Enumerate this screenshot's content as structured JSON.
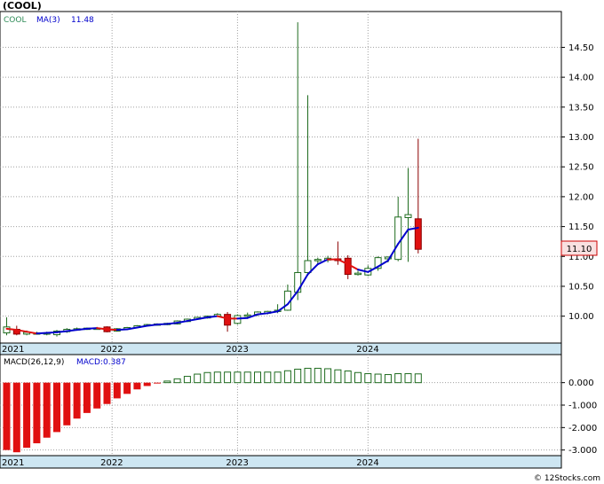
{
  "chart_data": {
    "type": "candlestick",
    "title": "(COOL)",
    "ticker_label": "COOL",
    "ma_label": "MA(3)",
    "ma_value": "11.48",
    "last_price": "11.10",
    "watermark": "© 12Stocks.com",
    "ylim": [
      9.55,
      15.1
    ],
    "yticks": [
      "10.00",
      "10.50",
      "11.00",
      "11.50",
      "12.00",
      "12.50",
      "13.00",
      "13.50",
      "14.00",
      "14.50"
    ],
    "years": [
      {
        "label": "2021",
        "index": 0
      },
      {
        "label": "2022",
        "index": 10.5
      },
      {
        "label": "2023",
        "index": 23
      },
      {
        "label": "2024",
        "index": 36
      }
    ],
    "candles": [
      {
        "o": 9.72,
        "h": 9.98,
        "l": 9.68,
        "c": 9.82,
        "up": true
      },
      {
        "o": 9.78,
        "h": 9.84,
        "l": 9.68,
        "c": 9.7,
        "up": false
      },
      {
        "o": 9.7,
        "h": 9.76,
        "l": 9.68,
        "c": 9.73,
        "up": true
      },
      {
        "o": 9.71,
        "h": 9.74,
        "l": 9.69,
        "c": 9.72,
        "up": true
      },
      {
        "o": 9.71,
        "h": 9.74,
        "l": 9.68,
        "c": 9.72,
        "up": true
      },
      {
        "o": 9.69,
        "h": 9.77,
        "l": 9.66,
        "c": 9.75,
        "up": true
      },
      {
        "o": 9.74,
        "h": 9.8,
        "l": 9.72,
        "c": 9.78,
        "up": true
      },
      {
        "o": 9.77,
        "h": 9.81,
        "l": 9.76,
        "c": 9.79,
        "up": true
      },
      {
        "o": 9.78,
        "h": 9.81,
        "l": 9.77,
        "c": 9.8,
        "up": true
      },
      {
        "o": 9.79,
        "h": 9.82,
        "l": 9.78,
        "c": 9.8,
        "up": true
      },
      {
        "o": 9.82,
        "h": 9.83,
        "l": 9.73,
        "c": 9.74,
        "up": false
      },
      {
        "o": 9.75,
        "h": 9.8,
        "l": 9.74,
        "c": 9.79,
        "up": true
      },
      {
        "o": 9.79,
        "h": 9.82,
        "l": 9.78,
        "c": 9.81,
        "up": true
      },
      {
        "o": 9.81,
        "h": 9.85,
        "l": 9.8,
        "c": 9.84,
        "up": true
      },
      {
        "o": 9.84,
        "h": 9.87,
        "l": 9.83,
        "c": 9.86,
        "up": true
      },
      {
        "o": 9.86,
        "h": 9.88,
        "l": 9.85,
        "c": 9.87,
        "up": true
      },
      {
        "o": 9.86,
        "h": 9.89,
        "l": 9.85,
        "c": 9.88,
        "up": true
      },
      {
        "o": 9.87,
        "h": 9.93,
        "l": 9.86,
        "c": 9.92,
        "up": true
      },
      {
        "o": 9.91,
        "h": 9.96,
        "l": 9.9,
        "c": 9.95,
        "up": true
      },
      {
        "o": 9.95,
        "h": 9.99,
        "l": 9.94,
        "c": 9.98,
        "up": true
      },
      {
        "o": 9.97,
        "h": 10.01,
        "l": 9.96,
        "c": 10.0,
        "up": true
      },
      {
        "o": 10.0,
        "h": 10.05,
        "l": 9.99,
        "c": 10.03,
        "up": true
      },
      {
        "o": 10.03,
        "h": 10.07,
        "l": 9.74,
        "c": 9.85,
        "up": false
      },
      {
        "o": 9.88,
        "h": 10.03,
        "l": 9.86,
        "c": 10.01,
        "up": true
      },
      {
        "o": 10.0,
        "h": 10.06,
        "l": 9.98,
        "c": 10.02,
        "up": true
      },
      {
        "o": 10.03,
        "h": 10.08,
        "l": 10.0,
        "c": 10.07,
        "up": true
      },
      {
        "o": 10.05,
        "h": 10.09,
        "l": 10.03,
        "c": 10.08,
        "up": true
      },
      {
        "o": 10.08,
        "h": 10.2,
        "l": 10.05,
        "c": 10.1,
        "up": true
      },
      {
        "o": 10.1,
        "h": 10.53,
        "l": 10.09,
        "c": 10.42,
        "up": true
      },
      {
        "o": 10.4,
        "h": 14.92,
        "l": 10.27,
        "c": 10.73,
        "up": true
      },
      {
        "o": 10.73,
        "h": 13.7,
        "l": 10.68,
        "c": 10.93,
        "up": true
      },
      {
        "o": 10.93,
        "h": 10.98,
        "l": 10.86,
        "c": 10.95,
        "up": true
      },
      {
        "o": 10.94,
        "h": 11.01,
        "l": 10.9,
        "c": 10.97,
        "up": true
      },
      {
        "o": 10.96,
        "h": 11.25,
        "l": 10.86,
        "c": 10.93,
        "up": false
      },
      {
        "o": 10.97,
        "h": 11.02,
        "l": 10.62,
        "c": 10.7,
        "up": false
      },
      {
        "o": 10.7,
        "h": 10.76,
        "l": 10.68,
        "c": 10.72,
        "up": true
      },
      {
        "o": 10.69,
        "h": 10.85,
        "l": 10.67,
        "c": 10.8,
        "up": true
      },
      {
        "o": 10.8,
        "h": 11.0,
        "l": 10.76,
        "c": 10.98,
        "up": true
      },
      {
        "o": 10.96,
        "h": 11.0,
        "l": 10.9,
        "c": 10.99,
        "up": true
      },
      {
        "o": 10.95,
        "h": 12.0,
        "l": 10.92,
        "c": 11.66,
        "up": true
      },
      {
        "o": 11.65,
        "h": 12.48,
        "l": 10.91,
        "c": 11.7,
        "up": true
      },
      {
        "o": 11.63,
        "h": 12.97,
        "l": 11.05,
        "c": 11.12,
        "up": false
      }
    ],
    "ma": [
      9.79,
      9.77,
      9.74,
      9.71,
      9.72,
      9.73,
      9.75,
      9.77,
      9.79,
      9.8,
      9.78,
      9.77,
      9.78,
      9.81,
      9.84,
      9.86,
      9.87,
      9.89,
      9.92,
      9.95,
      9.98,
      10.0,
      9.96,
      9.96,
      9.97,
      10.03,
      10.05,
      10.08,
      10.2,
      10.42,
      10.7,
      10.87,
      10.95,
      10.95,
      10.87,
      10.78,
      10.74,
      10.83,
      10.93,
      11.21,
      11.45,
      11.48
    ],
    "ma_direction": [
      "r",
      "r",
      "r",
      "r",
      "b",
      "b",
      "b",
      "b",
      "b",
      "b",
      "r",
      "r",
      "b",
      "b",
      "b",
      "b",
      "b",
      "b",
      "b",
      "b",
      "b",
      "b",
      "r",
      "r",
      "b",
      "b",
      "b",
      "b",
      "b",
      "b",
      "b",
      "b",
      "b",
      "r",
      "r",
      "r",
      "b",
      "b",
      "b",
      "b",
      "b",
      "b"
    ],
    "macd": {
      "label": "MACD(26,12,9)",
      "value_label": "MACD:0.387",
      "ylim": [
        -3.25,
        1.25
      ],
      "yticks": [
        "0.000",
        "-1.000",
        "-2.000",
        "-3.000"
      ],
      "values": [
        -3.0,
        -3.1,
        -2.9,
        -2.7,
        -2.45,
        -2.2,
        -1.9,
        -1.6,
        -1.35,
        -1.15,
        -0.95,
        -0.7,
        -0.5,
        -0.3,
        -0.15,
        -0.03,
        0.07,
        0.17,
        0.28,
        0.38,
        0.45,
        0.47,
        0.47,
        0.47,
        0.47,
        0.47,
        0.47,
        0.47,
        0.53,
        0.6,
        0.64,
        0.64,
        0.62,
        0.57,
        0.52,
        0.45,
        0.4,
        0.38,
        0.36,
        0.4,
        0.4,
        0.39
      ]
    }
  }
}
